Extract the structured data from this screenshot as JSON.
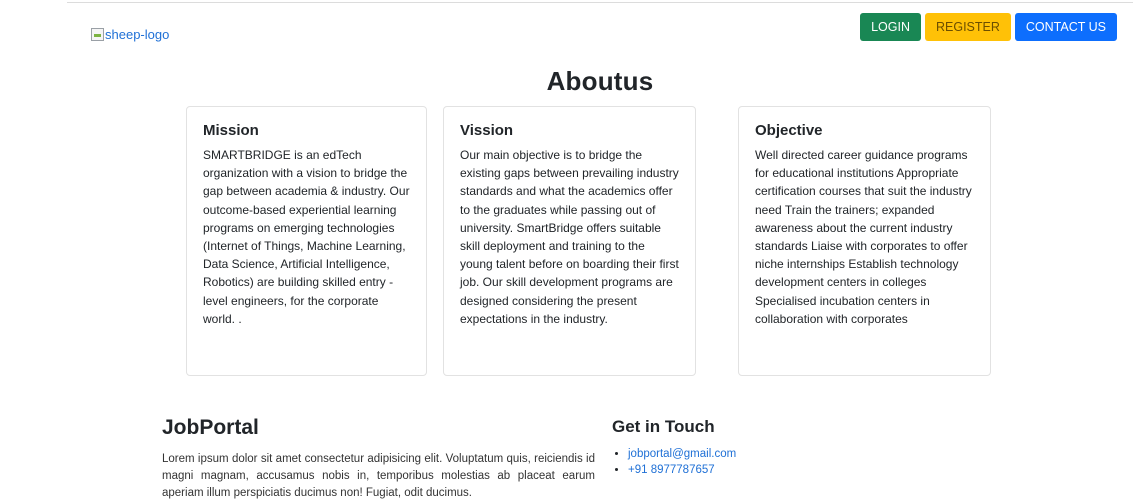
{
  "header": {
    "logo_alt": "sheep-logo",
    "buttons": {
      "login": "LOGIN",
      "register": "REGISTER",
      "contact": "CONTACT US"
    }
  },
  "about": {
    "title": "Aboutus",
    "cards": [
      {
        "title": "Mission",
        "text": "SMARTBRIDGE is an edTech organization with a vision to bridge the gap between academia & industry. Our outcome-based experiential learning programs on emerging technologies (Internet of Things, Machine Learning, Data Science, Artificial Intelligence, Robotics) are building skilled entry - level engineers, for the corporate world. ."
      },
      {
        "title": "Vission",
        "text": "Our main objective is to bridge the existing gaps between prevailing industry standards and what the academics offer to the graduates while passing out of university. SmartBridge offers suitable skill deployment and training to the young talent before on boarding their first job. Our skill development programs are designed considering the present expectations in the industry."
      },
      {
        "title": "Objective",
        "text": "Well directed career guidance programs for educational institutions Appropriate certification courses that suit the industry need Train the trainers; expanded awareness about the current industry standards Liaise with corporates to offer niche internships Establish technology development centers in colleges Specialised incubation centers in collaboration with corporates"
      }
    ]
  },
  "footer": {
    "jobportal_title": "JobPortal",
    "jobportal_text": "Lorem ipsum dolor sit amet consectetur adipisicing elit. Voluptatum quis, reiciendis id magni magnam, accusamus nobis in, temporibus molestias ab placeat earum aperiam illum perspiciatis ducimus non! Fugiat, odit ducimus.",
    "contact_title": "Get in Touch",
    "email": "jobportal@gmail.com",
    "phone": "+91 8977787657"
  },
  "colors": {
    "login": "#198754",
    "register": "#ffc107",
    "contact": "#0d6efd",
    "link": "#1f70d6"
  }
}
